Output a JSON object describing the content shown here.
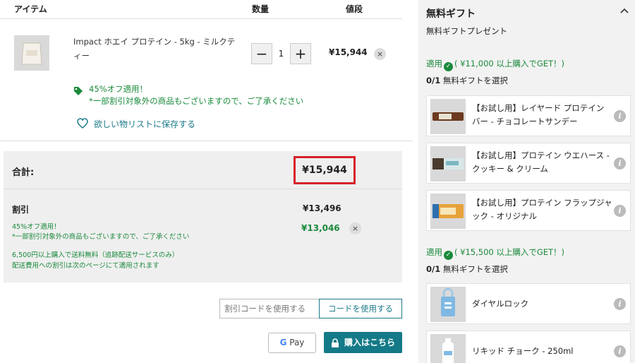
{
  "cart": {
    "header": {
      "item": "アイテム",
      "qty": "数量",
      "price": "値段"
    },
    "product": {
      "name_line1": "Impact ホエイ プロテイン - 5kg - ミルクテ",
      "name_line2": "ィー",
      "qty": "1",
      "price": "¥15,944",
      "promo_title": "45%オフ適用！",
      "promo_note": "*一部割引対象外の商品もございますので、ご了承ください",
      "wishlist": "欲しい物リストに保存する"
    },
    "qty_minus": "−",
    "qty_plus": "+",
    "remove": "×"
  },
  "summary": {
    "total_label": "合計:",
    "total_value": "¥15,944",
    "discount_label": "割引",
    "discount_value": "¥13,496",
    "promo_title": "45%オフ適用！",
    "promo_note": "*一部割引対象外の商品もございますので、ご了承ください",
    "saving_value": "¥13,046",
    "shipping_line1": "6,500円以上購入で送料無料（追跡配送サービスのみ）",
    "shipping_line2": "配送費用への割引は次のページにて適用されます",
    "remove": "×"
  },
  "coupon": {
    "placeholder": "割引コードを使用する",
    "button": "コードを使用する"
  },
  "checkout": {
    "gpay_g": "G",
    "gpay_text": " Pay",
    "buy": "購入はこちら"
  },
  "gifts": {
    "title": "無料ギフト",
    "subtitle": "無料ギフトプレゼント",
    "tier1": {
      "applied": "適用",
      "rule": "( ¥11,000 以上購入でGET！)",
      "select": "0/1",
      "select_text": " 無料ギフトを選択"
    },
    "tier1_items": [
      {
        "line1": "【お試し用】レイヤード プロテイン",
        "line2": "バー - チョコレートサンデー"
      },
      {
        "line1": "【お試し用】プロテイン ウエハース -",
        "line2": "クッキー & クリーム"
      },
      {
        "line1": "【お試し用】プロテイン フラップジャ",
        "line2": "ック - オリジナル"
      }
    ],
    "tier2": {
      "applied": "適用",
      "rule": "( ¥15,500 以上購入でGET！)",
      "select": "0/1",
      "select_text": " 無料ギフトを選択"
    },
    "tier2_items": [
      {
        "line1": "ダイヤルロック"
      },
      {
        "line1": "リキッド チョーク - 250ml"
      }
    ],
    "info": "i",
    "check": "✓"
  },
  "colors": {
    "accent": "#147a87",
    "green": "#1a8a3c",
    "highlight": "#d6222a"
  }
}
